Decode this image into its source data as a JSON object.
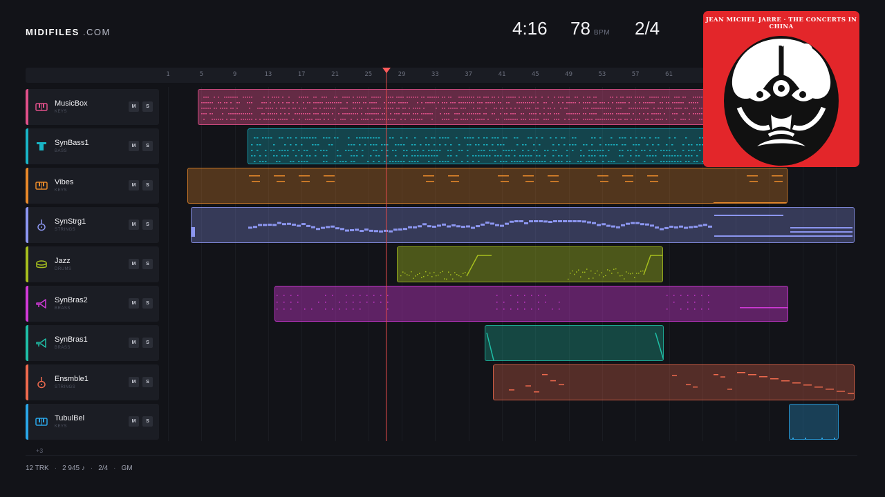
{
  "header": {
    "logo_bold": "MIDIFILES",
    "logo_light": ".COM",
    "duration": "4:16",
    "tempo_value": "78",
    "tempo_unit": "BPM",
    "time_signature": "2/4"
  },
  "ruler": {
    "ticks": [
      "1",
      "5",
      "9",
      "13",
      "17",
      "21",
      "25",
      "29",
      "33",
      "37",
      "41",
      "45",
      "49",
      "53",
      "57",
      "61"
    ]
  },
  "tracks": [
    {
      "name": "MusicBox",
      "category": "KEYS",
      "color": "#e0508a",
      "icon": "piano-keys-icon",
      "mute": "M",
      "solo": "S"
    },
    {
      "name": "SynBass1",
      "category": "BASS",
      "color": "#19b5c6",
      "icon": "bass-icon",
      "mute": "M",
      "solo": "S"
    },
    {
      "name": "Vibes",
      "category": "KEYS",
      "color": "#e8892a",
      "icon": "piano-keys-icon",
      "mute": "M",
      "solo": "S"
    },
    {
      "name": "SynStrg1",
      "category": "STRINGS",
      "color": "#8c96f0",
      "icon": "violin-icon",
      "mute": "M",
      "solo": "S"
    },
    {
      "name": "Jazz",
      "category": "DRUMS",
      "color": "#a6bf1e",
      "icon": "drum-icon",
      "mute": "M",
      "solo": "S"
    },
    {
      "name": "SynBras2",
      "category": "BRASS",
      "color": "#d13ad8",
      "icon": "horn-icon",
      "mute": "M",
      "solo": "S"
    },
    {
      "name": "SynBras1",
      "category": "BRASS",
      "color": "#1fbfa6",
      "icon": "horn-icon",
      "mute": "M",
      "solo": "S"
    },
    {
      "name": "Ensmble1",
      "category": "STRINGS",
      "color": "#ee6a4e",
      "icon": "violin-icon",
      "mute": "M",
      "solo": "S"
    },
    {
      "name": "TubulBel",
      "category": "KEYS",
      "color": "#2aa6e8",
      "icon": "piano-keys-icon",
      "mute": "M",
      "solo": "S"
    }
  ],
  "more_tracks": "+3",
  "footer": {
    "tracks": "12 TRK",
    "notes": "2 945 ♪",
    "time_signature": "2/4",
    "standard": "GM"
  },
  "album": {
    "title": "JEAN MICHEL JARRE · THE CONCERTS IN CHINA"
  }
}
